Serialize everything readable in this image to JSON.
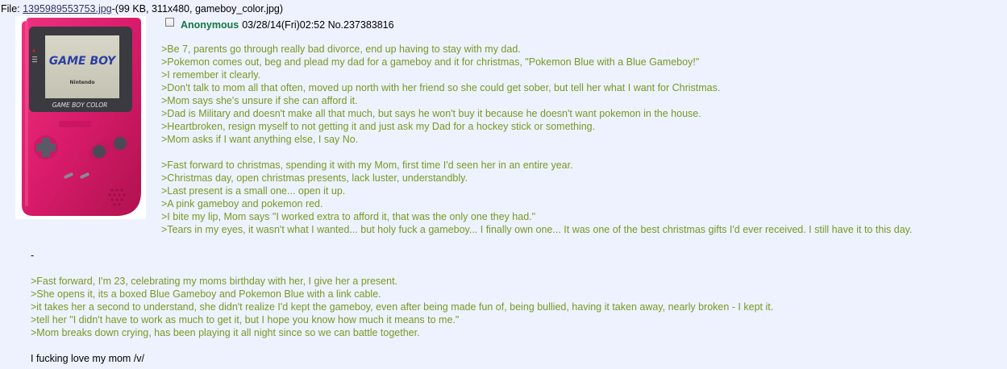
{
  "file": {
    "label": "File:",
    "filename": "1395989553753.jpg",
    "info": "-(99 KB, 311x480, gameboy_color.jpg)"
  },
  "thumbnail": {
    "alt": "Pink Game Boy Color",
    "screen_brand": "GAME BOY",
    "screen_sub": "Nintendo",
    "model_label": "GAME BOY COLOR",
    "body_color": "#d81b6a",
    "screen_bezel_color": "#3a3a40"
  },
  "post": {
    "name": "Anonymous",
    "datetime": "03/28/14(Fri)02:52",
    "number_label": "No.237383816",
    "name_color": "#117743",
    "greentext_color": "#789922"
  },
  "body": {
    "block1": [
      ">Be 7, parents go through really bad divorce, end up having to stay with my dad.",
      ">Pokemon comes out, beg and plead my dad for a gameboy and it for christmas, \"Pokemon Blue with a Blue Gameboy!\"",
      ">I remember it clearly.",
      ">Don't talk to mom all that often, moved up north with her friend so she could get sober, but tell her what I want for Christmas.",
      ">Mom says she's unsure if she can afford it.",
      ">Dad is Military and doesn't make all that much, but says he won't buy it because he doesn't want pokemon in the house.",
      ">Heartbroken, resign myself to not getting it and just ask my Dad for a hockey stick or something.",
      ">Mom asks if I want anything else, I say No."
    ],
    "block2": [
      ">Fast forward to christmas, spending it with my Mom, first time I'd seen her in an entire year.",
      ">Christmas day, open christmas presents, lack luster, understandbly.",
      ">Last present is a small one... open it up.",
      ">A pink gameboy and pokemon red.",
      ">I bite my lip, Mom says \"I worked extra to afford it, that was the only one they had.\"",
      ">Tears in my eyes, it wasn't what I wanted... but holy fuck a gameboy... I finally own one... It was one of the best christmas gifts I'd ever received. I still have it to this day."
    ],
    "dash": "-",
    "block3": [
      ">Fast forward, I'm 23, celebrating my moms birthday with her, I give her a present.",
      ">She opens it, its a boxed Blue Gameboy and Pokemon Blue with a link cable.",
      ">it takes her a second to understand, she didn't realize I'd kept the gameboy, even after being made fun of, being bullied, having it taken away, nearly broken - I kept it.",
      ">tell her \"I didn't have to work as much to get it, but I hope you know how much it means to me.\"",
      ">Mom breaks down crying, has been playing it all night since so we can battle together."
    ],
    "closing": "I fucking love my mom /v/"
  }
}
